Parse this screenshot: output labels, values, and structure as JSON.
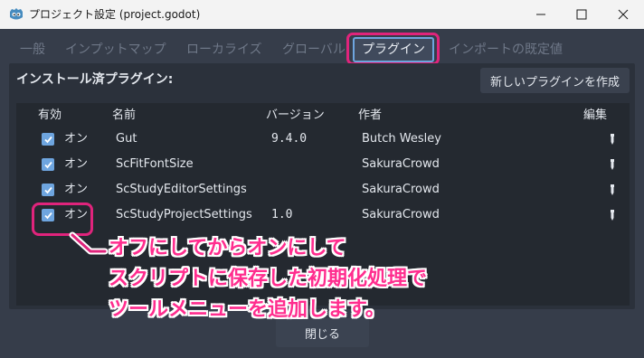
{
  "window": {
    "title": "プロジェクト設定 (project.godot)"
  },
  "tabs": [
    {
      "label": "一般"
    },
    {
      "label": "インプットマップ"
    },
    {
      "label": "ローカライズ"
    },
    {
      "label": "グローバル"
    },
    {
      "label": "プラグイン",
      "active": true
    },
    {
      "label": "インポートの既定値"
    }
  ],
  "plugins": {
    "section_title": "インストール済プラグイン:",
    "create_button": "新しいプラグインを作成",
    "columns": {
      "enabled": "有効",
      "name": "名前",
      "version": "バージョン",
      "author": "作者",
      "edit": "編集"
    },
    "rows": [
      {
        "enabled": true,
        "state": "オン",
        "name": "Gut",
        "version": "9.4.0",
        "author": "Butch Wesley"
      },
      {
        "enabled": true,
        "state": "オン",
        "name": "ScFitFontSize",
        "version": "",
        "author": "SakuraCrowd"
      },
      {
        "enabled": true,
        "state": "オン",
        "name": "ScStudyEditorSettings",
        "version": "",
        "author": "SakuraCrowd"
      },
      {
        "enabled": true,
        "state": "オン",
        "name": "ScStudyProjectSettings",
        "version": "1.0",
        "author": "SakuraCrowd"
      }
    ]
  },
  "annotation": {
    "lines": [
      "オフにしてからオンにして",
      "スクリプトに保存した初期化処理で",
      "ツールメニューを追加します。"
    ],
    "color": "#ff2d8e"
  },
  "footer": {
    "close_button": "閉じる"
  },
  "colors": {
    "accent": "#6ea5df",
    "highlight": "#e0247c"
  }
}
